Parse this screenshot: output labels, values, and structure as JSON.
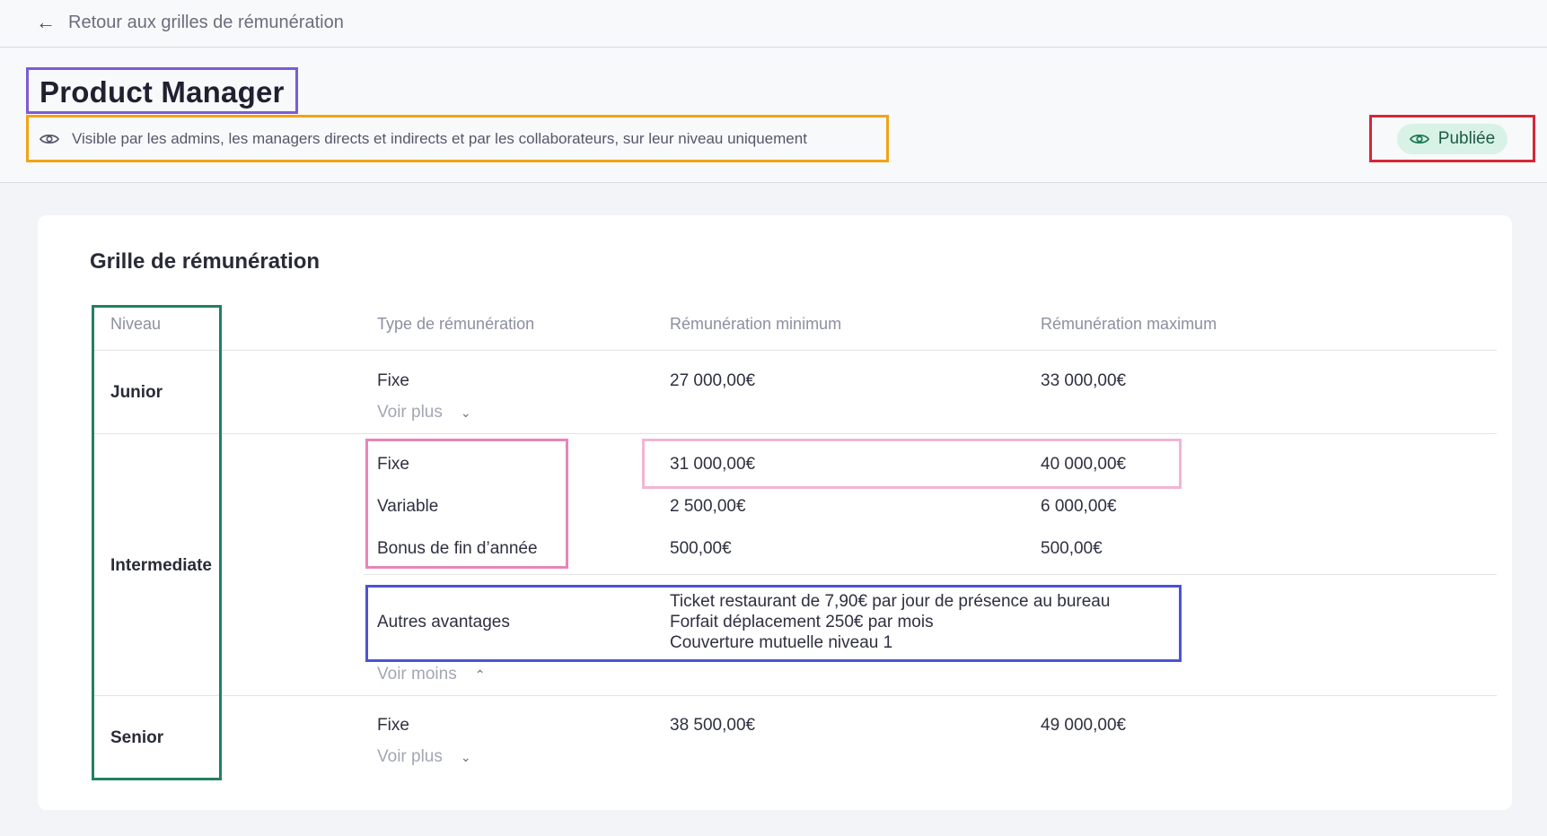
{
  "nav": {
    "back_label": "Retour aux grilles de rémunération"
  },
  "header": {
    "title": "Product Manager",
    "visibility": "Visible par les admins, les managers directs et indirects et par les collaborateurs, sur leur niveau uniquement",
    "status": "Publiée"
  },
  "card": {
    "title": "Grille de rémunération",
    "columns": [
      "Niveau",
      "Type de rémunération",
      "Rémunération minimum",
      "Rémunération maximum"
    ],
    "levels": [
      {
        "name": "Junior",
        "rows": [
          {
            "type": "Fixe",
            "min": "27 000,00€",
            "max": "33 000,00€"
          }
        ],
        "toggle": "Voir plus"
      },
      {
        "name": "Intermediate",
        "rows": [
          {
            "type": "Fixe",
            "min": "31 000,00€",
            "max": "40 000,00€"
          },
          {
            "type": "Variable",
            "min": "2 500,00€",
            "max": "6 000,00€"
          },
          {
            "type": "Bonus de fin d’année",
            "min": "500,00€",
            "max": "500,00€"
          }
        ],
        "other_label": "Autres avantages",
        "other_values": [
          "Ticket restaurant de 7,90€ par jour de présence au bureau",
          "Forfait déplacement 250€ par mois",
          "Couverture mutuelle niveau 1"
        ],
        "toggle": "Voir moins"
      },
      {
        "name": "Senior",
        "rows": [
          {
            "type": "Fixe",
            "min": "38 500,00€",
            "max": "49 000,00€"
          }
        ],
        "toggle": "Voir plus"
      }
    ]
  },
  "colors": {
    "accent_green": "#23805f",
    "status_bg": "#d9f2e6"
  },
  "icons": {
    "back": "arrow-left-icon",
    "eye": "eye-icon",
    "chevron_down": "chevron-down-icon",
    "chevron_up": "chevron-up-icon"
  }
}
